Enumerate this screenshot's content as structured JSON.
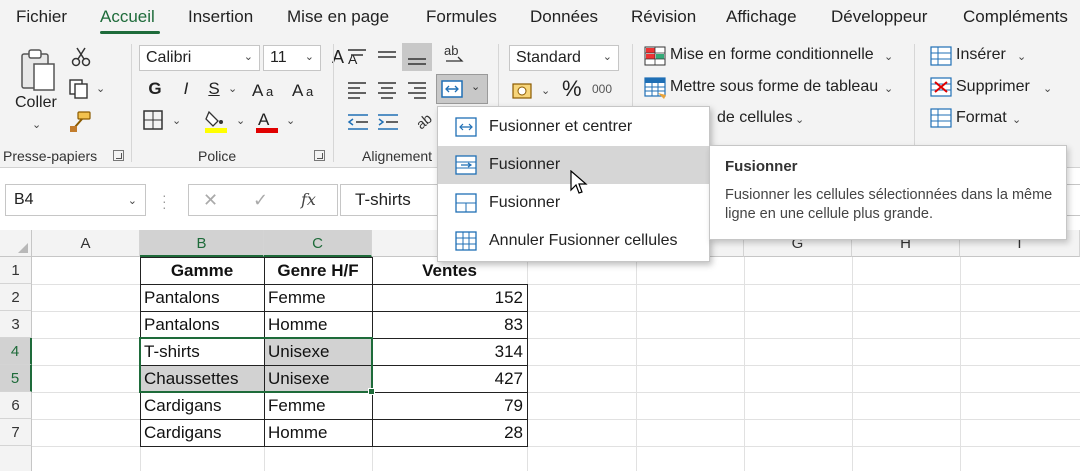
{
  "menu": {
    "tabs": [
      "Fichier",
      "Accueil",
      "Insertion",
      "Mise en page",
      "Formules",
      "Données",
      "Révision",
      "Affichage",
      "Développeur",
      "Compléments"
    ],
    "active": "Accueil"
  },
  "ribbon": {
    "clipboard": {
      "paste_label": "Coller",
      "group_label": "Presse-papiers"
    },
    "font": {
      "name": "Calibri",
      "size": "11",
      "bold": "G",
      "italic": "I",
      "underline": "S",
      "group_label": "Police",
      "grow_a": "A",
      "shrink_a": "A"
    },
    "alignment": {
      "group_label": "Alignement"
    },
    "number": {
      "format": "Standard",
      "percent": "%",
      "thousands": "000"
    },
    "styles": {
      "conditional": "Mise en forme conditionnelle",
      "as_table": "Mettre sous forme de tableau",
      "cell_styles": "de cellules"
    },
    "cells": {
      "insert": "Insérer",
      "delete": "Supprimer",
      "format": "Format"
    }
  },
  "formula_bar": {
    "name_box": "B4",
    "formula": "T-shirts",
    "fx": "fx"
  },
  "grid": {
    "columns": [
      "A",
      "B",
      "C",
      "",
      "",
      "",
      "G",
      "H",
      "I"
    ],
    "rows": [
      "1",
      "2",
      "3",
      "4",
      "5",
      "6",
      "7"
    ],
    "table": {
      "headers": [
        "Gamme",
        "Genre H/F",
        "Ventes"
      ],
      "rows": [
        [
          "Pantalons",
          "Femme",
          "152"
        ],
        [
          "Pantalons",
          "Homme",
          "83"
        ],
        [
          "T-shirts",
          "Unisexe",
          "314"
        ],
        [
          "Chaussettes",
          "Unisexe",
          "427"
        ],
        [
          "Cardigans",
          "Femme",
          "79"
        ],
        [
          "Cardigans",
          "Homme",
          "28"
        ]
      ]
    }
  },
  "merge_menu": {
    "items": [
      {
        "label": "Fusionner et centrer",
        "icon": "merge-center-icon"
      },
      {
        "label": "Fusionner",
        "icon": "merge-across-icon"
      },
      {
        "label": "Fusionner",
        "icon": "merge-cells-icon"
      },
      {
        "label": "Annuler Fusionner cellules",
        "icon": "unmerge-icon"
      }
    ],
    "hover_index": 1
  },
  "tooltip": {
    "title": "Fusionner",
    "description": "Fusionner les cellules sélectionnées dans la même ligne en une cellule plus grande."
  },
  "colors": {
    "accent": "#1e6b3a",
    "highlight": "#ffff00",
    "font_color": "#e00000"
  }
}
